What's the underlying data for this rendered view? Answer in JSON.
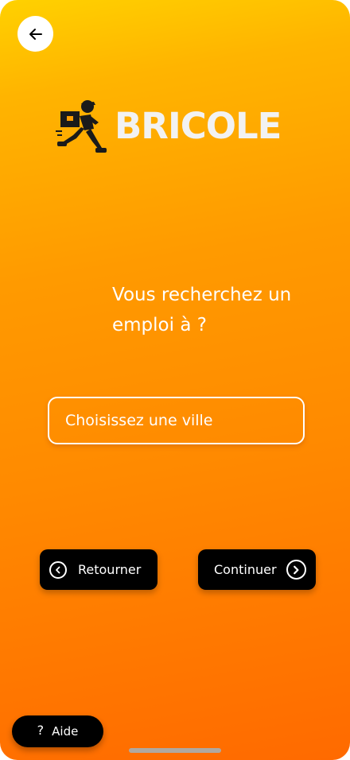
{
  "header": {
    "back_icon": "arrow-left-icon"
  },
  "logo": {
    "text": "BRICOLE",
    "icon": "delivery-runner-icon"
  },
  "main": {
    "question": "Vous recherchez un emploi à ?",
    "city_placeholder": "Choisissez une ville",
    "city_value": ""
  },
  "actions": {
    "back_label": "Retourner",
    "back_icon": "chevron-left-circle-icon",
    "next_label": "Continuer",
    "next_icon": "chevron-right-circle-icon"
  },
  "help": {
    "icon": "question-icon",
    "icon_glyph": "?",
    "label": "Aide"
  },
  "colors": {
    "gradient_top": "#ffd100",
    "gradient_bottom": "#ff6a00",
    "button_bg": "#000000",
    "text": "#ffffff"
  }
}
